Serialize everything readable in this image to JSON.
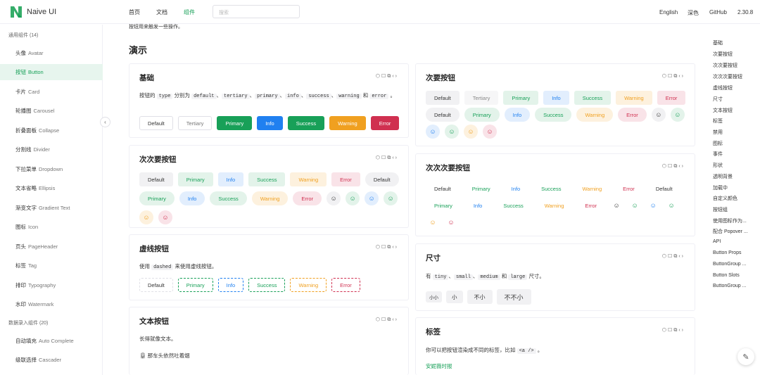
{
  "header": {
    "brand": "Naive UI",
    "nav": [
      "首页",
      "文档",
      "组件"
    ],
    "search_placeholder": "搜索",
    "lang": "English",
    "theme": "深色",
    "github": "GitHub",
    "version": "2.30.8"
  },
  "sidebar": {
    "group1": "通用组件 (14)",
    "items": [
      {
        "cn": "头像",
        "en": "Avatar"
      },
      {
        "cn": "按钮",
        "en": "Button"
      },
      {
        "cn": "卡片",
        "en": "Card"
      },
      {
        "cn": "轮播图",
        "en": "Carousel"
      },
      {
        "cn": "折叠面板",
        "en": "Collapse"
      },
      {
        "cn": "分割线",
        "en": "Divider"
      },
      {
        "cn": "下拉菜单",
        "en": "Dropdown"
      },
      {
        "cn": "文本省略",
        "en": "Ellipsis"
      },
      {
        "cn": "渐变文字",
        "en": "Gradient Text"
      },
      {
        "cn": "图标",
        "en": "Icon"
      },
      {
        "cn": "页头",
        "en": "PageHeader"
      },
      {
        "cn": "标签",
        "en": "Tag"
      },
      {
        "cn": "排印",
        "en": "Typography"
      },
      {
        "cn": "水印",
        "en": "Watermark"
      }
    ],
    "group2": "数据录入组件 (20)",
    "items2": [
      {
        "cn": "自动填充",
        "en": "Auto Complete"
      },
      {
        "cn": "级联选择",
        "en": "Cascader"
      }
    ]
  },
  "main": {
    "intro": "按钮用来触发一些操作。",
    "demo_heading": "演示",
    "basic": {
      "title": "基础",
      "desc_parts": [
        "按钮的",
        "type",
        "分别为",
        "default",
        "、",
        "tertiary",
        "、",
        "primary",
        "、",
        "info",
        "、",
        "success",
        "、",
        "warning",
        "和",
        "error",
        "。"
      ],
      "buttons": [
        "Default",
        "Tertiary",
        "Primary",
        "Info",
        "Success",
        "Warning",
        "Error"
      ]
    },
    "secondary": {
      "title": "次要按钮",
      "row1": [
        "Default",
        "Tertiary",
        "Primary",
        "Info",
        "Success",
        "Warning",
        "Error"
      ],
      "row2": [
        "Default",
        "Primary",
        "Info",
        "Success",
        "Warning",
        "Error"
      ]
    },
    "tertiary": {
      "title": "次次要按钮",
      "row1": [
        "Default",
        "Primary",
        "Info",
        "Success",
        "Warning",
        "Error",
        "Default"
      ],
      "row2": [
        "Primary",
        "Info",
        "Success",
        "Warning",
        "Error"
      ]
    },
    "quaternary": {
      "title": "次次次要按钮",
      "row1": [
        "Default",
        "Primary",
        "Info",
        "Success",
        "Warning",
        "Error",
        "Default"
      ],
      "row2": [
        "Primary",
        "Info",
        "Success",
        "Warning",
        "Error"
      ]
    },
    "dashed": {
      "title": "虚线按钮",
      "desc_pre": "使用",
      "desc_code": "dashed",
      "desc_post": "来使用虚线按钮。",
      "buttons": [
        "Default",
        "Primary",
        "Info",
        "Success",
        "Warning",
        "Error"
      ]
    },
    "size": {
      "title": "尺寸",
      "desc_pre": "有",
      "codes": [
        "tiny",
        "small",
        "medium",
        "large"
      ],
      "sep": "、",
      "and": "和",
      "desc_post": "尺寸。",
      "buttons": [
        "小小",
        "小",
        "不小",
        "不不小"
      ]
    },
    "text": {
      "title": "文本按钮",
      "desc": "长得就像文本。",
      "link": "那车头依然吐着烟"
    },
    "tag": {
      "title": "标签",
      "desc_pre": "你可以把按钮渲染成不同的标签，比如",
      "desc_code": "<a />",
      "desc_post": "。",
      "link": "安妮薇时报"
    }
  },
  "toc": [
    "基础",
    "次要按钮",
    "次次要按钮",
    "次次次要按钮",
    "虚线按钮",
    "尺寸",
    "文本按钮",
    "标签",
    "禁用",
    "图标",
    "事件",
    "形状",
    "透明背景",
    "加载中",
    "自定义颜色",
    "按钮组",
    "使用图标作为...",
    "配合 Popover ...",
    "API",
    "Button Props",
    "ButtonGroup ...",
    "Button Slots",
    "ButtonGroup ..."
  ],
  "colors": {
    "primary": "#18a058",
    "info": "#2080f0",
    "warning": "#f0a020",
    "error": "#d03050"
  }
}
